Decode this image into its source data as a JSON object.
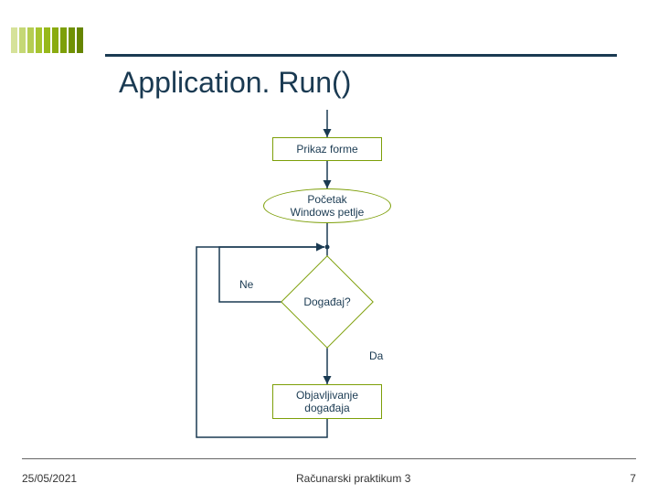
{
  "header": {
    "title": "Application. Run()"
  },
  "flow": {
    "prikaz": "Prikaz forme",
    "pocetak_line1": "Početak",
    "pocetak_line2": "Windows petlje",
    "ne": "Ne",
    "dogadjaj": "Događaj?",
    "da": "Da",
    "objav_line1": "Objavljivanje",
    "objav_line2": "događaja"
  },
  "footer": {
    "date": "25/05/2021",
    "course": "Računarski praktikum 3",
    "page": "7"
  },
  "chart_data": {
    "type": "flowchart",
    "title": "Application.Run()",
    "nodes": [
      {
        "id": "prikaz",
        "shape": "rect",
        "label": "Prikaz forme"
      },
      {
        "id": "pocetak",
        "shape": "ellipse",
        "label": "Početak Windows petlje"
      },
      {
        "id": "dogadjaj",
        "shape": "diamond",
        "label": "Događaj?"
      },
      {
        "id": "objav",
        "shape": "rect",
        "label": "Objavljivanje događaja"
      }
    ],
    "edges": [
      {
        "from": "start",
        "to": "prikaz"
      },
      {
        "from": "prikaz",
        "to": "pocetak"
      },
      {
        "from": "pocetak",
        "to": "dogadjaj"
      },
      {
        "from": "dogadjaj",
        "to": "objav",
        "label": "Da"
      },
      {
        "from": "dogadjaj",
        "to": "pocetak",
        "label": "Ne",
        "loop": true
      },
      {
        "from": "objav",
        "to": "pocetak",
        "loop": true
      }
    ]
  }
}
